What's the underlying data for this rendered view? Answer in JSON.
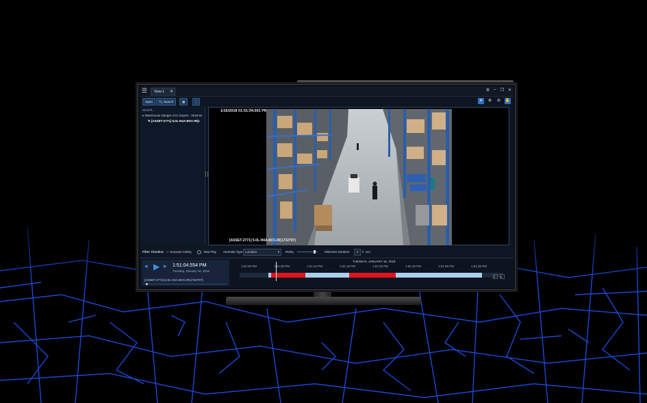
{
  "app": {
    "tab_label": "View 1",
    "toolbar": {
      "open_label": "Open",
      "search_label": "Search"
    },
    "left_panel": {
      "search_label": "Search...",
      "tree": [
        "Warehouse Danger ACC Export - 2018-01",
        "[ASSET-2771] 5.0L-H4A-BO1-IR(1"
      ]
    },
    "video": {
      "timestamp": "1/16/2018 01:51:04.561 PM (PST)",
      "asset": "[ASSET-2771] 5.0L-H4A-BO1-IR(1732797)"
    },
    "filter": {
      "title": "Filter Timeline:",
      "unusual_activity": "Unusual Activity",
      "skip_play": "Skip Play",
      "anomaly_type_label": "Anomaly Type",
      "anomaly_type_value": "Location",
      "rarity_label": "Rarity",
      "minimum_duration_label": "Minimum Duration",
      "minimum_duration_value": "2",
      "sec_label": "sec"
    },
    "playback": {
      "time": "1:51:04.554 PM",
      "date": "Tuesday, January 16, 2018",
      "asset": "[ASSET-2771] 5.0L-H4A-BO1-IR(1732797)"
    },
    "timeline": {
      "date": "TUESDAY, JANUARY 16, 2018",
      "ticks": [
        "1:51:00 PM",
        "1:51:05 PM",
        "1:51:10 PM",
        "1:51:15 PM",
        "1:51:20 PM",
        "1:51:25 PM",
        "1:51:30 PM",
        "1:51:35 PM"
      ]
    },
    "colors": {
      "accent": "#2f6fc4",
      "anomaly": "#e0141e",
      "normal": "#a9cfee"
    }
  }
}
